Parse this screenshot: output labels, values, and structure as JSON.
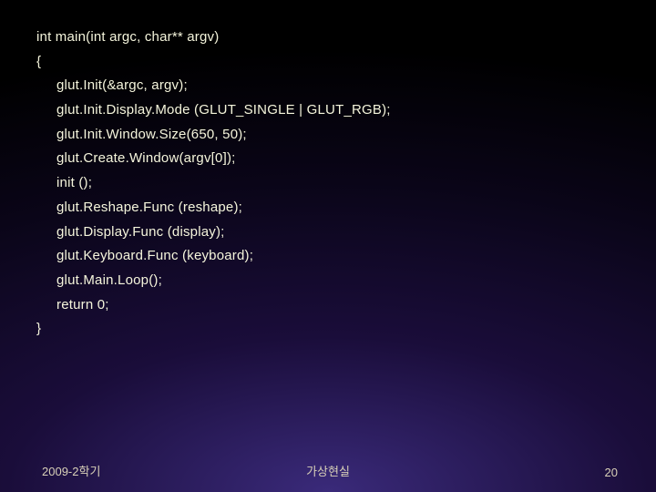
{
  "code": {
    "l0": "int main(int argc, char** argv)",
    "l1": "{",
    "l2": "glut.Init(&argc, argv);",
    "l3": "glut.Init.Display.Mode (GLUT_SINGLE | GLUT_RGB);",
    "l4": "glut.Init.Window.Size(650, 50);",
    "l5": "glut.Create.Window(argv[0]);",
    "l6": "init ();",
    "l7": "glut.Reshape.Func (reshape);",
    "l8": "glut.Display.Func (display);",
    "l9": "glut.Keyboard.Func (keyboard);",
    "l10": "glut.Main.Loop();",
    "l11": "return 0;",
    "l12": "}"
  },
  "footer": {
    "left": "2009-2학기",
    "center": "가상현실",
    "right": "20"
  }
}
